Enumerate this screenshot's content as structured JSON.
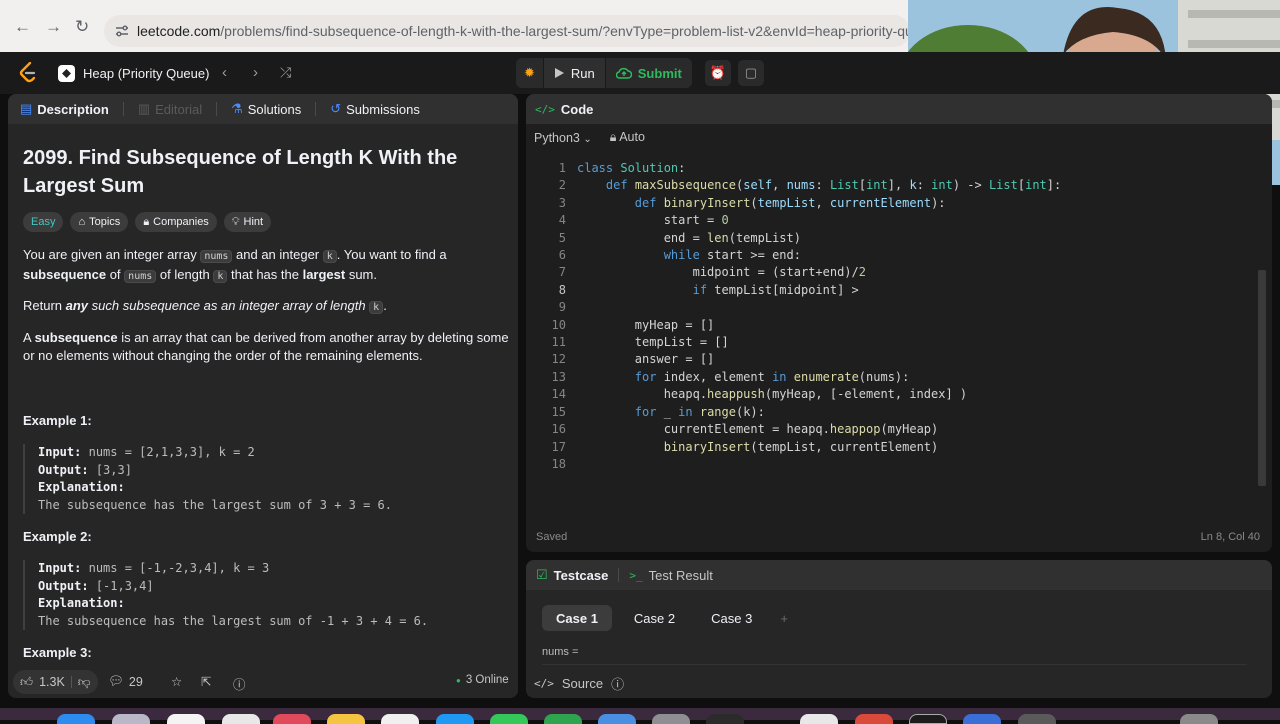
{
  "browser": {
    "url_host": "leetcode.com",
    "url_path": "/problems/find-subsequence-of-length-k-with-the-largest-sum/?envType=problem-list-v2&envId=heap-priority-queue"
  },
  "topbar": {
    "problem_list": "Heap (Priority Queue)",
    "run_label": "Run",
    "submit_label": "Submit"
  },
  "left_tabs": {
    "description": "Description",
    "editorial": "Editorial",
    "solutions": "Solutions",
    "submissions": "Submissions"
  },
  "problem": {
    "title": "2099. Find Subsequence of Length K With the Largest Sum",
    "difficulty": "Easy",
    "tag_topics": "Topics",
    "tag_companies": "Companies",
    "tag_hint": "Hint",
    "p1_a": "You are given an integer array ",
    "p1_code1": "nums",
    "p1_b": " and an integer ",
    "p1_code2": "k",
    "p1_c": ". You want to find a ",
    "p1_bold1": "subsequence",
    "p1_d": " of ",
    "p1_code3": "nums",
    "p1_e": " of length ",
    "p1_code4": "k",
    "p1_f": " that has the ",
    "p1_bold2": "largest",
    "p1_g": " sum.",
    "p2_a": "Return ",
    "p2_bold": "any",
    "p2_b": " such subsequence as an integer array of length ",
    "p2_code": "k",
    "p2_c": ".",
    "p3_a": "A ",
    "p3_bold": "subsequence",
    "p3_b": " is an array that can be derived from another array by deleting some or no elements without changing the order of the remaining elements."
  },
  "examples": [
    {
      "heading": "Example 1:",
      "input_label": "Input:",
      "input": "nums = [2,1,3,3], k = 2",
      "output_label": "Output:",
      "output": "[3,3]",
      "explanation_label": "Explanation:",
      "explanation": "The subsequence has the largest sum of 3 + 3 = 6."
    },
    {
      "heading": "Example 2:",
      "input_label": "Input:",
      "input": "nums = [-1,-2,3,4], k = 3",
      "output_label": "Output:",
      "output": "[-1,3,4]",
      "explanation_label": "Explanation:",
      "explanation": "The subsequence has the largest sum of -1 + 3 + 4 = 6."
    },
    {
      "heading": "Example 3:"
    }
  ],
  "footer": {
    "likes": "1.3K",
    "comments": "29",
    "online": "3 Online"
  },
  "code_panel": {
    "title": "Code",
    "language": "Python3",
    "mode": "Auto",
    "status": "Saved",
    "cursor": "Ln 8, Col 40",
    "line_numbers": [
      "1",
      "2",
      "3",
      "4",
      "5",
      "6",
      "7",
      "8",
      "9",
      "10",
      "11",
      "12",
      "13",
      "14",
      "15",
      "16",
      "17",
      "18"
    ]
  },
  "test_panel": {
    "testcase_tab": "Testcase",
    "result_tab": "Test Result",
    "cases": [
      "Case 1",
      "Case 2",
      "Case 3"
    ],
    "add_case": "+",
    "nums_label": "nums =",
    "source_label": "Source"
  }
}
